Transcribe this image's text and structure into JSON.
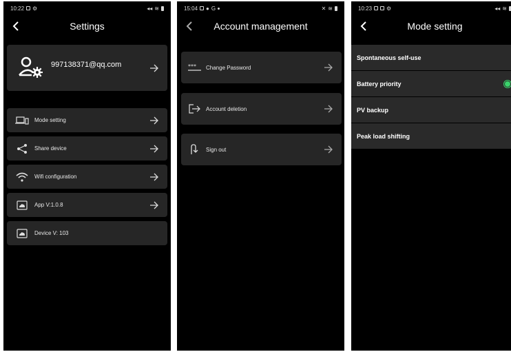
{
  "screen1": {
    "status_time": "10:22",
    "title": "Settings",
    "account_email": "997138371@qq.com",
    "items": [
      {
        "label": "Mode setting",
        "icon": "devices-icon"
      },
      {
        "label": "Share device",
        "icon": "share-icon"
      },
      {
        "label": "Wifi configuration",
        "icon": "wifi-icon"
      },
      {
        "label": "App V:1.0.8",
        "icon": "cloud-icon"
      },
      {
        "label": "Device V: 103",
        "icon": "cloud-icon"
      }
    ]
  },
  "screen2": {
    "status_time": "15:04",
    "title": "Account management",
    "items": [
      {
        "label": "Change Password",
        "icon": "password-icon"
      },
      {
        "label": "Account deletion",
        "icon": "logout-icon"
      },
      {
        "label": "Sign out",
        "icon": "sign-out-icon"
      }
    ]
  },
  "screen3": {
    "status_time": "10:23",
    "title": "Mode setting",
    "modes": [
      {
        "label": "Spontaneous self-use",
        "selected": false
      },
      {
        "label": "Battery priority",
        "selected": true
      },
      {
        "label": "PV backup",
        "selected": false
      },
      {
        "label": "Peak load shifting",
        "selected": false
      }
    ]
  },
  "colors": {
    "background": "#000000",
    "card": "#262626",
    "accent": "#3ad36b",
    "text": "#ffffff"
  }
}
